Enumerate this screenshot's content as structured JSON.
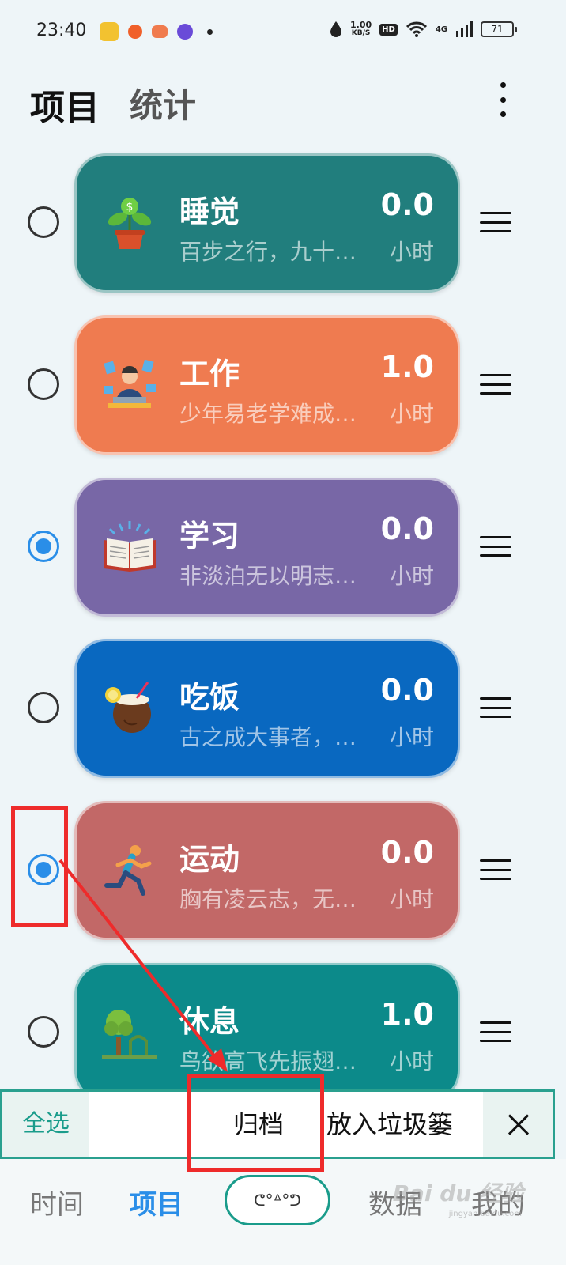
{
  "status_bar": {
    "time": "23:40",
    "speed_value": "1.00",
    "speed_unit": "KB/S",
    "hd": "HD",
    "network": "4G",
    "battery": "71"
  },
  "header": {
    "tab_projects": "项目",
    "tab_stats": "统计"
  },
  "projects": [
    {
      "name": "睡觉",
      "desc": "百步之行，九十…",
      "hours": "0.0",
      "unit": "小时",
      "selected": false,
      "color": "#217e7d",
      "icon": "money-plant-icon"
    },
    {
      "name": "工作",
      "desc": "少年易老学难成…",
      "hours": "1.0",
      "unit": "小时",
      "selected": false,
      "color": "#ef7b50",
      "icon": "office-worker-icon"
    },
    {
      "name": "学习",
      "desc": "非淡泊无以明志…",
      "hours": "0.0",
      "unit": "小时",
      "selected": true,
      "color": "#7867a6",
      "icon": "open-book-icon"
    },
    {
      "name": "吃饭",
      "desc": "古之成大事者，…",
      "hours": "0.0",
      "unit": "小时",
      "selected": false,
      "color": "#0968c0",
      "icon": "coconut-drink-icon"
    },
    {
      "name": "运动",
      "desc": "胸有凌云志，无…",
      "hours": "0.0",
      "unit": "小时",
      "selected": true,
      "color": "#c26867",
      "icon": "runner-icon"
    },
    {
      "name": "休息",
      "desc": "鸟欲高飞先振翅…",
      "hours": "1.0",
      "unit": "小时",
      "selected": false,
      "color": "#0c8a8a",
      "icon": "tree-icon"
    }
  ],
  "action_bar": {
    "select_all": "全选",
    "archive": "归档",
    "trash": "放入垃圾篓"
  },
  "bottom_nav": {
    "time": "时间",
    "projects": "项目",
    "center": "ᕦ°ᐞ°ᕤ",
    "data": "数据",
    "mine": "我的"
  },
  "watermark": {
    "brand": "Bai du 经验",
    "url": "jingyan.baidu.com"
  },
  "colors": {
    "accent": "#2a8ee8",
    "teal": "#1a9c8b",
    "annotation": "#ee2b2b"
  }
}
